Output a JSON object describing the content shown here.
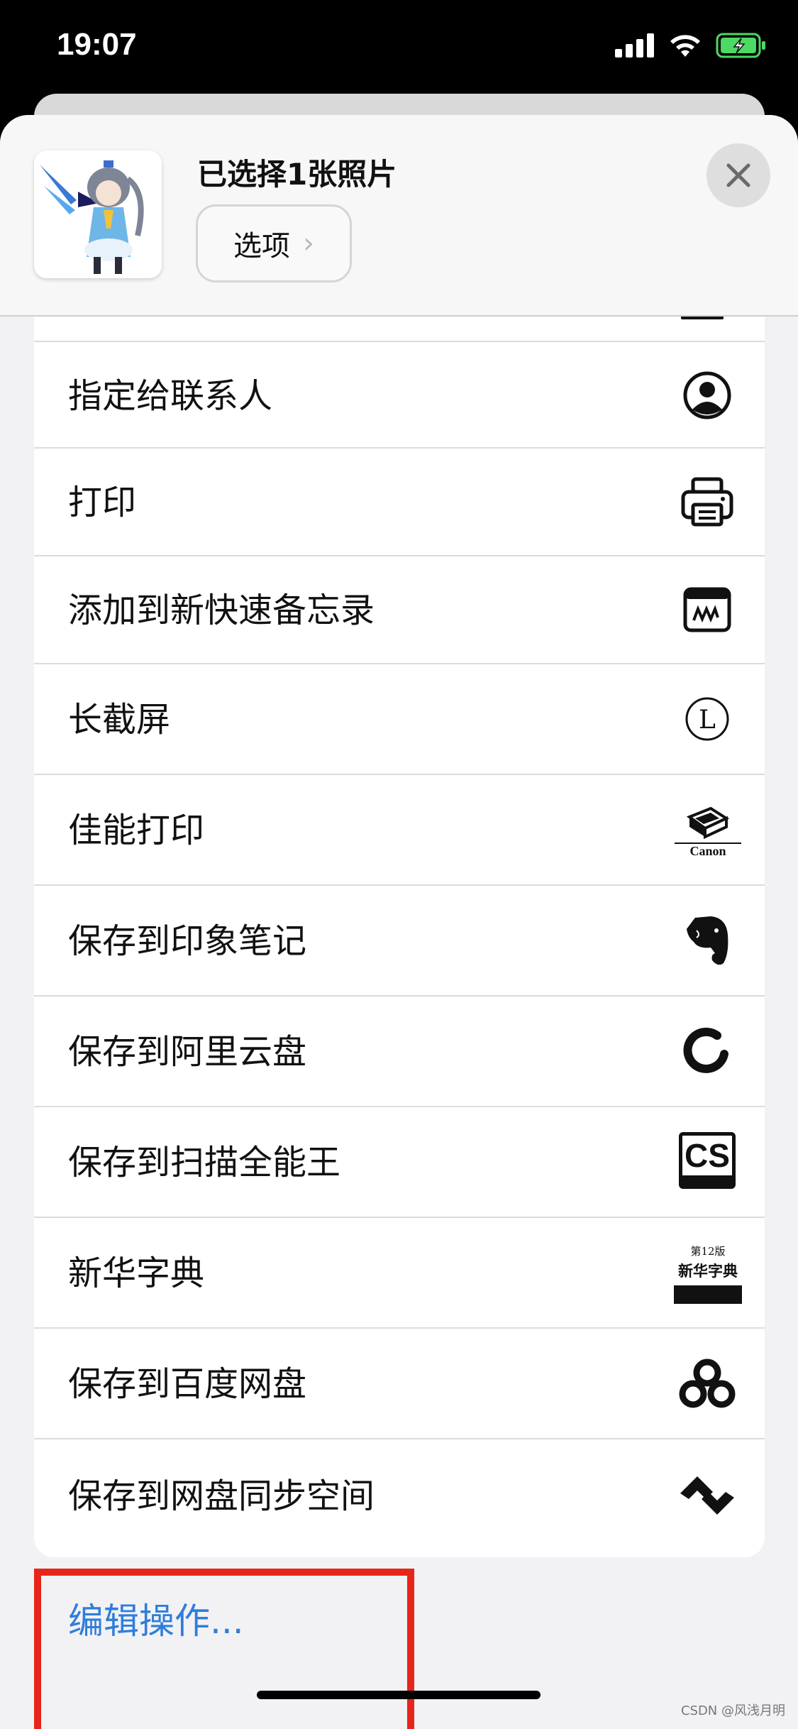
{
  "status": {
    "time": "19:07"
  },
  "header": {
    "title": "已选择1张照片",
    "options_label": "选项"
  },
  "actions": [
    {
      "label": "指定给联系人",
      "icon": "contact-icon"
    },
    {
      "label": "打印",
      "icon": "printer-icon"
    },
    {
      "label": "添加到新快速备忘录",
      "icon": "quick-note-icon"
    },
    {
      "label": "长截屏",
      "icon": "long-screenshot-icon"
    },
    {
      "label": "佳能打印",
      "icon": "canon-print-icon",
      "icon_text": "Canon"
    },
    {
      "label": "保存到印象笔记",
      "icon": "evernote-icon"
    },
    {
      "label": "保存到阿里云盘",
      "icon": "aliyun-drive-icon"
    },
    {
      "label": "保存到扫描全能王",
      "icon": "camscanner-icon",
      "icon_text": "CS"
    },
    {
      "label": "新华字典",
      "icon": "xinhua-dictionary-icon",
      "icon_text": "新华字典",
      "icon_edition": "第12版"
    },
    {
      "label": "保存到百度网盘",
      "icon": "baidu-netdisk-icon"
    },
    {
      "label": "保存到网盘同步空间",
      "icon": "sync-space-icon"
    }
  ],
  "footer": {
    "edit_actions_label": "编辑操作..."
  },
  "watermark": "CSDN @风浅月明",
  "colors": {
    "link": "#2f7ddc",
    "highlight": "#e6261a",
    "battery": "#4cd964"
  }
}
